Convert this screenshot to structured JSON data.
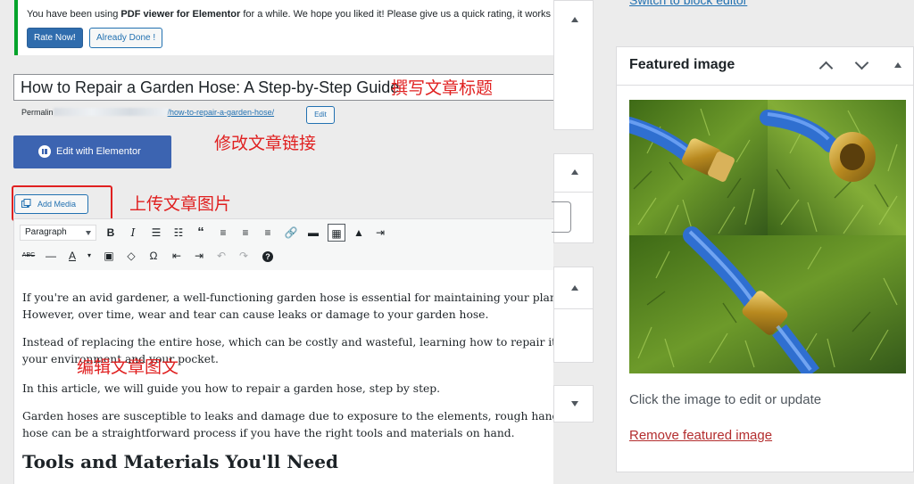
{
  "notice": {
    "text_before": "You have been using ",
    "text_bold": "PDF viewer for Elementor",
    "text_after": " for a while. We hope you liked it! Please give us a quick rating, it works as a l",
    "rate_now": "Rate Now!",
    "already_done": "Already Done !"
  },
  "post": {
    "title": "How to Repair a Garden Hose: A Step-by-Step Guide",
    "permalink_label": "Permalin",
    "permalink_slug": "/how-to-repair-a-garden-hose/",
    "edit_label": "Edit",
    "elementor_label": "Edit with Elementor",
    "add_media_label": "Add Media"
  },
  "annotations": {
    "title_note": "撰写文章标题",
    "link_note": "修改文章链接",
    "media_note": "上传文章图片",
    "content_note": "编辑文章图文"
  },
  "toolbar": {
    "format_select": "Paragraph",
    "row1_icons": [
      "bold-icon",
      "italic-icon",
      "bullet-list-icon",
      "numbered-list-icon",
      "blockquote-icon",
      "align-left-icon",
      "align-center-icon",
      "align-right-icon",
      "link-icon",
      "read-more-icon",
      "toolbar-toggle-icon",
      "fullscreen-icon",
      "distraction-free-icon"
    ],
    "row2_icons": [
      "strikethrough-icon",
      "horizontal-line-icon",
      "text-color-icon",
      "paste-text-icon",
      "clear-formatting-icon",
      "special-character-icon",
      "outdent-icon",
      "indent-icon",
      "undo-icon",
      "redo-icon",
      "help-icon"
    ]
  },
  "content": {
    "p1_line1": "If you're an avid gardener, a well-functioning garden hose is essential for maintaining your plants and keep",
    "p1_line2": "However, over time, wear and tear can cause leaks or damage to your garden hose.",
    "p2_line1": "Instead of replacing the entire hose, which can be costly and wasteful, learning how to repair it yourself can",
    "p2_line2": "your environment and your pocket.",
    "p3": "In this article, we will guide you how to repair a garden hose, step by step.",
    "p4_line1": "Garden hoses are susceptible to leaks and damage due to exposure to the elements, rough handling, and oth",
    "p4_line2": "hose can be a straightforward process if you have the right tools and materials on hand.",
    "heading": "Tools and Materials You'll Need"
  },
  "sidebar": {
    "top_link": "Switch to block editor",
    "featured_title": "Featured image",
    "featured_hint": "Click the image to edit or update",
    "remove_label": "Remove featured image"
  },
  "colors": {
    "accent": "#2271b1",
    "notice_border": "#00a32a",
    "annotation_red": "#e02020",
    "elementor_blue": "#3c64b1",
    "hose_blue": "#2f6fd0"
  }
}
